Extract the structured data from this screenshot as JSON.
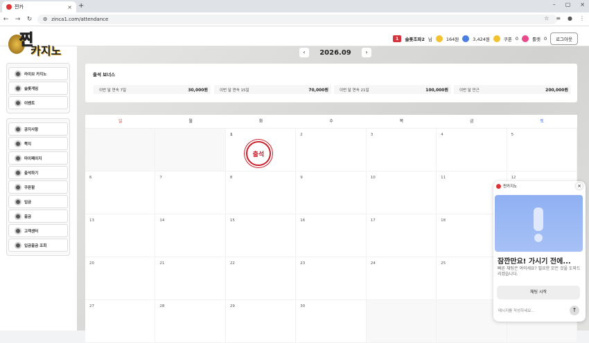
{
  "browser": {
    "tab_title": "찐카",
    "url": "zinca1.com/attendance"
  },
  "header": {
    "logo_line1": "찐",
    "logo_line2": "카지노",
    "level": "1",
    "username": "슬롯조파2",
    "suffix": "님",
    "points": "164원",
    "money": "3,424원",
    "coupon_label": "쿠폰",
    "coupon_count": "0",
    "roulette_label": "룰렛",
    "roulette_count": "0",
    "logout": "로그아웃"
  },
  "sidebar": {
    "top": [
      {
        "label": "라이브 카지노"
      },
      {
        "label": "슬롯게임"
      },
      {
        "label": "이벤트"
      }
    ],
    "bottom": [
      {
        "label": "공지사항"
      },
      {
        "label": "쪽지"
      },
      {
        "label": "마이페이지"
      },
      {
        "label": "출석하기"
      },
      {
        "label": "쿠폰함"
      },
      {
        "label": "입금"
      },
      {
        "label": "출금"
      },
      {
        "label": "고객센터"
      },
      {
        "label": "입금출금 조회"
      }
    ]
  },
  "calendar": {
    "month": "2026.09",
    "prev": "‹",
    "next": "›",
    "bonus_title": "출석 보너스",
    "bonuses": [
      {
        "label": "이번 달 연속 7일",
        "amount": "30,000원"
      },
      {
        "label": "이번 달 연속 15일",
        "amount": "70,000원"
      },
      {
        "label": "이번 달 연속 21일",
        "amount": "100,000원"
      },
      {
        "label": "이번 달 만근",
        "amount": "200,000원"
      }
    ],
    "weekdays": [
      "일",
      "월",
      "화",
      "수",
      "목",
      "금",
      "토"
    ],
    "stamp": "출석"
  },
  "colors": {
    "sunday": "#d23a3a",
    "saturday": "#2a5bd7",
    "stamp": "#c81e2a"
  },
  "chat": {
    "name": "찐카지노",
    "heading": "잠깐만요! 가시기 전에...",
    "body": "빠른 채팅은 여의세요? 필요한 모든 것을 도와드리겠습니다.",
    "button": "채팅 시작",
    "placeholder": "메시지를 작성하세요..."
  }
}
